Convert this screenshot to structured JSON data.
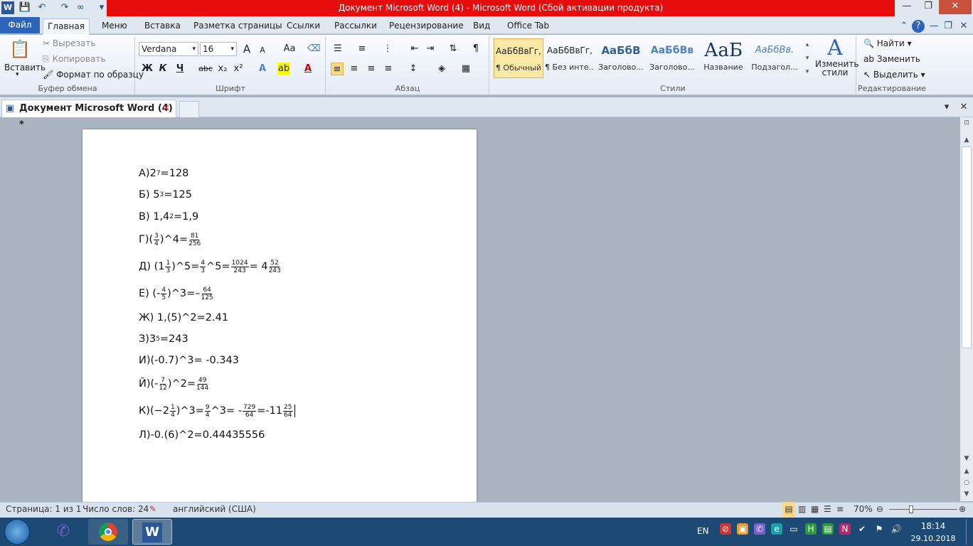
{
  "window": {
    "title": "Документ Microsoft Word (4)  -  Microsoft Word (Сбой активации продукта)"
  },
  "tabs": {
    "file": "Файл",
    "home": "Главная",
    "menu": "Меню",
    "insert": "Вставка",
    "layout": "Разметка страницы",
    "refs": "Ссылки",
    "mail": "Рассылки",
    "review": "Рецензирование",
    "view": "Вид",
    "officetab": "Office Tab"
  },
  "clipboard": {
    "paste": "Вставить",
    "cut": "Вырезать",
    "copy": "Копировать",
    "format": "Формат по образцу",
    "label": "Буфер обмена"
  },
  "font": {
    "name": "Verdana",
    "size": "16",
    "label": "Шрифт",
    "bold": "Ж",
    "italic": "К",
    "underline": "Ч",
    "strike": "abc",
    "sub": "x₂",
    "sup": "x²",
    "case": "Aa",
    "grow": "A",
    "shrink": "A"
  },
  "paragraph": {
    "label": "Абзац"
  },
  "styles": {
    "label": "Стили",
    "items": [
      {
        "preview": "АаБбВвГг,",
        "name": "¶ Обычный"
      },
      {
        "preview": "АаБбВвГг,",
        "name": "¶ Без инте..."
      },
      {
        "preview": "АаБбВ",
        "name": "Заголово..."
      },
      {
        "preview": "АаБбВв",
        "name": "Заголово..."
      },
      {
        "preview": "АаБ",
        "name": "Название"
      },
      {
        "preview": "АаБбВв.",
        "name": "Подзагол..."
      }
    ],
    "change": "Изменить стили"
  },
  "editing": {
    "find": "Найти",
    "replace": "Заменить",
    "select": "Выделить",
    "label": "Редактирование"
  },
  "doctab": {
    "title": "Документ Microsoft Word (4) *"
  },
  "doc": {
    "a": {
      "p": "А)2",
      "e": "7",
      "s": "=128"
    },
    "b": {
      "p": "Б) 5",
      "e": "3",
      "s": "=125"
    },
    "v": {
      "p": "В) 1,4",
      "e": "2",
      "s": "=1,9"
    },
    "g": {
      "p": "Г)(",
      "fn": "3",
      "fd": "4",
      "m": ")^4=",
      "rn": "81",
      "rd": "256"
    },
    "d": {
      "p": "Д) (1",
      "fn": "1",
      "fd": "3",
      "m": ")^5= ",
      "f2n": "4",
      "f2d": "3",
      "m2": "^5=",
      "f3n": "1024",
      "f3d": "243",
      "m3": "= 4",
      "f4n": "52",
      "f4d": "243"
    },
    "e": {
      "p": "Е) (-",
      "fn": "4",
      "fd": "5",
      "m": ")^3=–",
      "rn": "64",
      "rd": "125"
    },
    "zh": {
      "t": "Ж) 1,(5)^2=2.41"
    },
    "z": {
      "p": "З)3",
      "e": "5",
      "s": "=243"
    },
    "i": {
      "t": "И)(-0.7)^3= -0.343"
    },
    "y": {
      "p": "Й)(- ",
      "fn": "7",
      "fd": "12",
      "m": ")^2= ",
      "rn": "49",
      "rd": "144"
    },
    "k": {
      "p": "К)(−2",
      "fn": "1",
      "fd": "4",
      "m": ")^3=",
      "f2n": "9",
      "f2d": "4",
      "m2": "^3= - ",
      "f3n": "729",
      "f3d": "64",
      "m3": "=-11",
      "f4n": "25",
      "f4d": "64"
    },
    "l": {
      "t": "Л)-0.(6)^2=0.44435556"
    }
  },
  "status": {
    "page": "Страница: 1 из 1",
    "words": "Число слов: 24",
    "lang": "английский (США)",
    "zoom": "70%"
  },
  "tray": {
    "lang": "EN",
    "time": "18:14",
    "date": "29.10.2018"
  }
}
